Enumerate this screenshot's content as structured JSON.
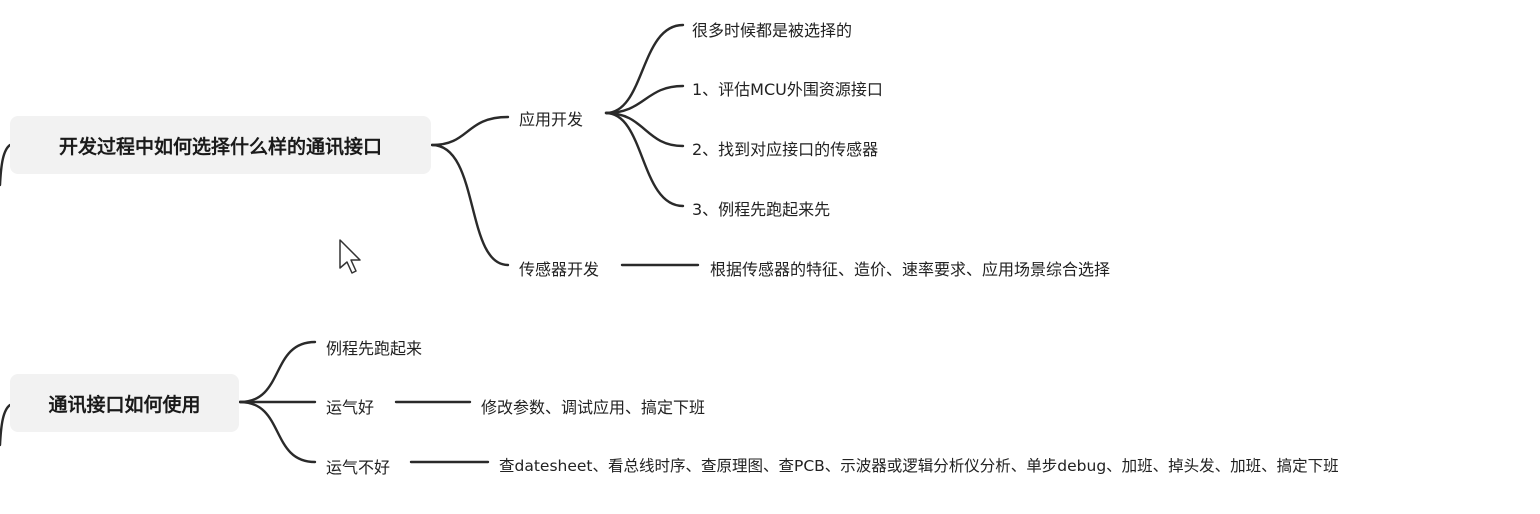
{
  "mindmap": {
    "root1": {
      "label": "开发过程中如何选择什么样的通讯接口",
      "branches": [
        {
          "label": "应用开发",
          "children": [
            "很多时候都是被选择的",
            "1、评估MCU外围资源接口",
            "2、找到对应接口的传感器",
            "3、例程先跑起来先"
          ]
        },
        {
          "label": "传感器开发",
          "children": [
            "根据传感器的特征、造价、速率要求、应用场景综合选择"
          ]
        }
      ]
    },
    "root2": {
      "label": "通讯接口如何使用",
      "branches": [
        {
          "label": "例程先跑起来",
          "children": []
        },
        {
          "label": "运气好",
          "children": [
            "修改参数、调试应用、搞定下班"
          ]
        },
        {
          "label": "运气不好",
          "children": [
            "查datesheet、看总线时序、查原理图、查PCB、示波器或逻辑分析仪分析、单步debug、加班、掉头发、加班、搞定下班"
          ]
        }
      ]
    }
  }
}
